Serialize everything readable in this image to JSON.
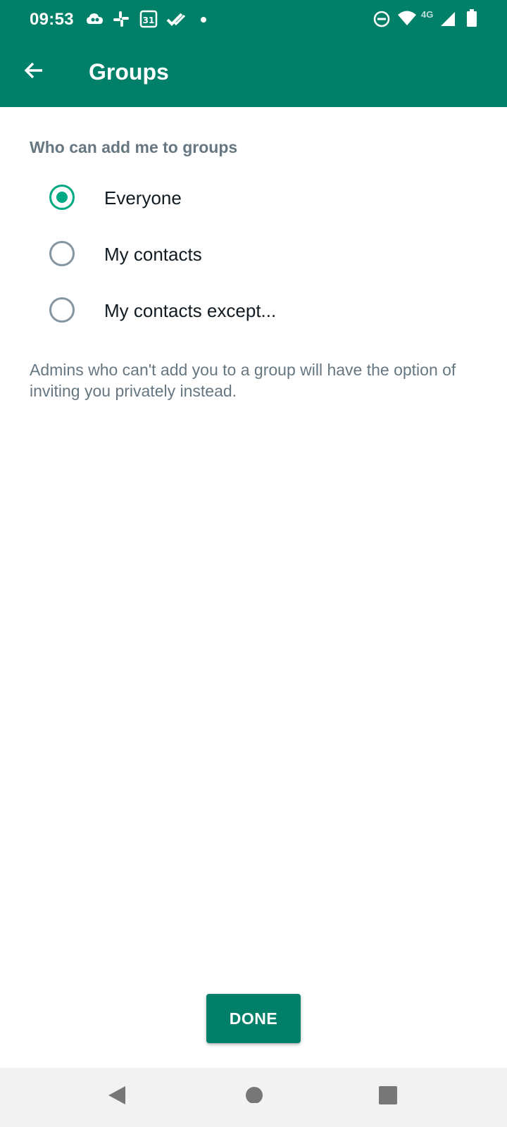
{
  "status_bar": {
    "time": "09:53",
    "calendar_day": "31",
    "network_type": "4G",
    "icons": [
      "cloud-icon",
      "slack-icon",
      "calendar-icon",
      "check-icon",
      "notification-dot-icon",
      "dnd-icon",
      "wifi-icon",
      "signal-icon",
      "battery-icon"
    ]
  },
  "toolbar": {
    "title": "Groups",
    "back_icon": "arrow-left-icon"
  },
  "content": {
    "section_header": "Who can add me to groups",
    "options": [
      {
        "label": "Everyone",
        "selected": true
      },
      {
        "label": "My contacts",
        "selected": false
      },
      {
        "label": "My contacts except...",
        "selected": false
      }
    ],
    "footer_note": "Admins who can't add you to a group will have the option of inviting you privately instead."
  },
  "actions": {
    "done_label": "DONE"
  },
  "nav_bar": {
    "icons": [
      "back-triangle-icon",
      "home-circle-icon",
      "recents-square-icon"
    ]
  },
  "colors": {
    "primary": "#008069",
    "accent": "#00a884",
    "secondary_text": "#667781",
    "primary_text": "#111b21"
  }
}
